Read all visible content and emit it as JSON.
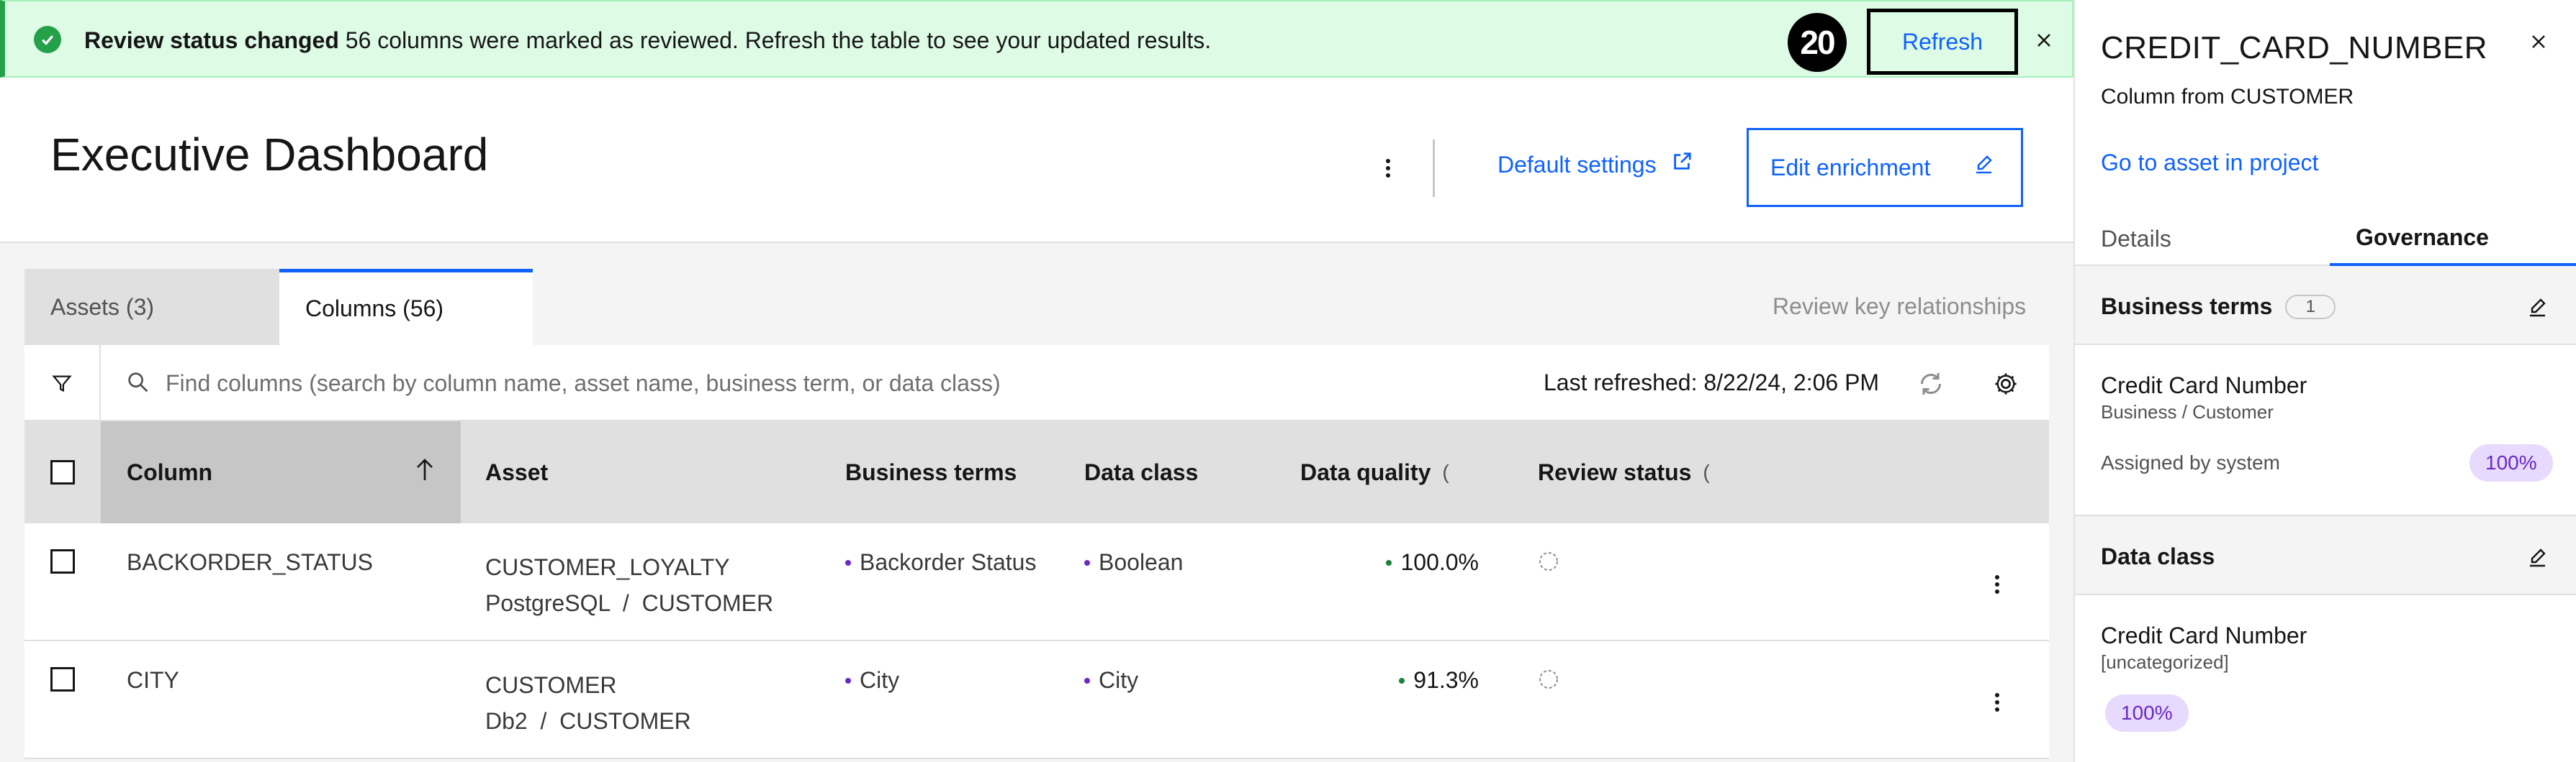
{
  "notification": {
    "title": "Review status changed",
    "message": "56 columns were marked as reviewed. Refresh the table to see your updated results.",
    "step_badge": "20",
    "refresh_label": "Refresh",
    "status_color": "#24a148"
  },
  "header": {
    "title": "Executive Dashboard",
    "default_settings_label": "Default settings",
    "edit_enrichment_label": "Edit enrichment"
  },
  "tabs": [
    {
      "label": "Assets (3)",
      "selected": false
    },
    {
      "label": "Columns (56)",
      "selected": true
    }
  ],
  "review_key_relationships_label": "Review key relationships",
  "toolbar": {
    "search_placeholder": "Find columns (search by column name, asset name, business term, or data class)",
    "last_refreshed": "Last refreshed: 8/22/24, 2:06 PM"
  },
  "table": {
    "headers": {
      "column": "Column",
      "asset": "Asset",
      "business_terms": "Business terms",
      "data_class": "Data class",
      "data_quality": "Data quality",
      "review_status": "Review status"
    },
    "rows": [
      {
        "column": "BACKORDER_STATUS",
        "asset": "CUSTOMER_LOYALTY",
        "asset_source": "PostgreSQL  /  CUSTOMER",
        "business_term": "Backorder Status",
        "data_class": "Boolean",
        "data_quality": "100.0%"
      },
      {
        "column": "CITY",
        "asset": "CUSTOMER",
        "asset_source": "Db2  /  CUSTOMER",
        "business_term": "City",
        "data_class": "City",
        "data_quality": "91.3%"
      }
    ]
  },
  "panel": {
    "title": "CREDIT_CARD_NUMBER",
    "subtitle": "Column from CUSTOMER",
    "link": "Go to asset in project",
    "tabs": [
      {
        "label": "Details",
        "selected": false
      },
      {
        "label": "Governance",
        "selected": true
      }
    ],
    "business_terms": {
      "title": "Business terms",
      "count": "1",
      "item_name": "Credit Card Number",
      "item_path": "Business / Customer",
      "assigned": "Assigned by system",
      "confidence": "100%"
    },
    "data_class": {
      "title": "Data class",
      "item_name": "Credit Card Number",
      "item_category": "[uncategorized]",
      "confidence": "100%"
    }
  }
}
